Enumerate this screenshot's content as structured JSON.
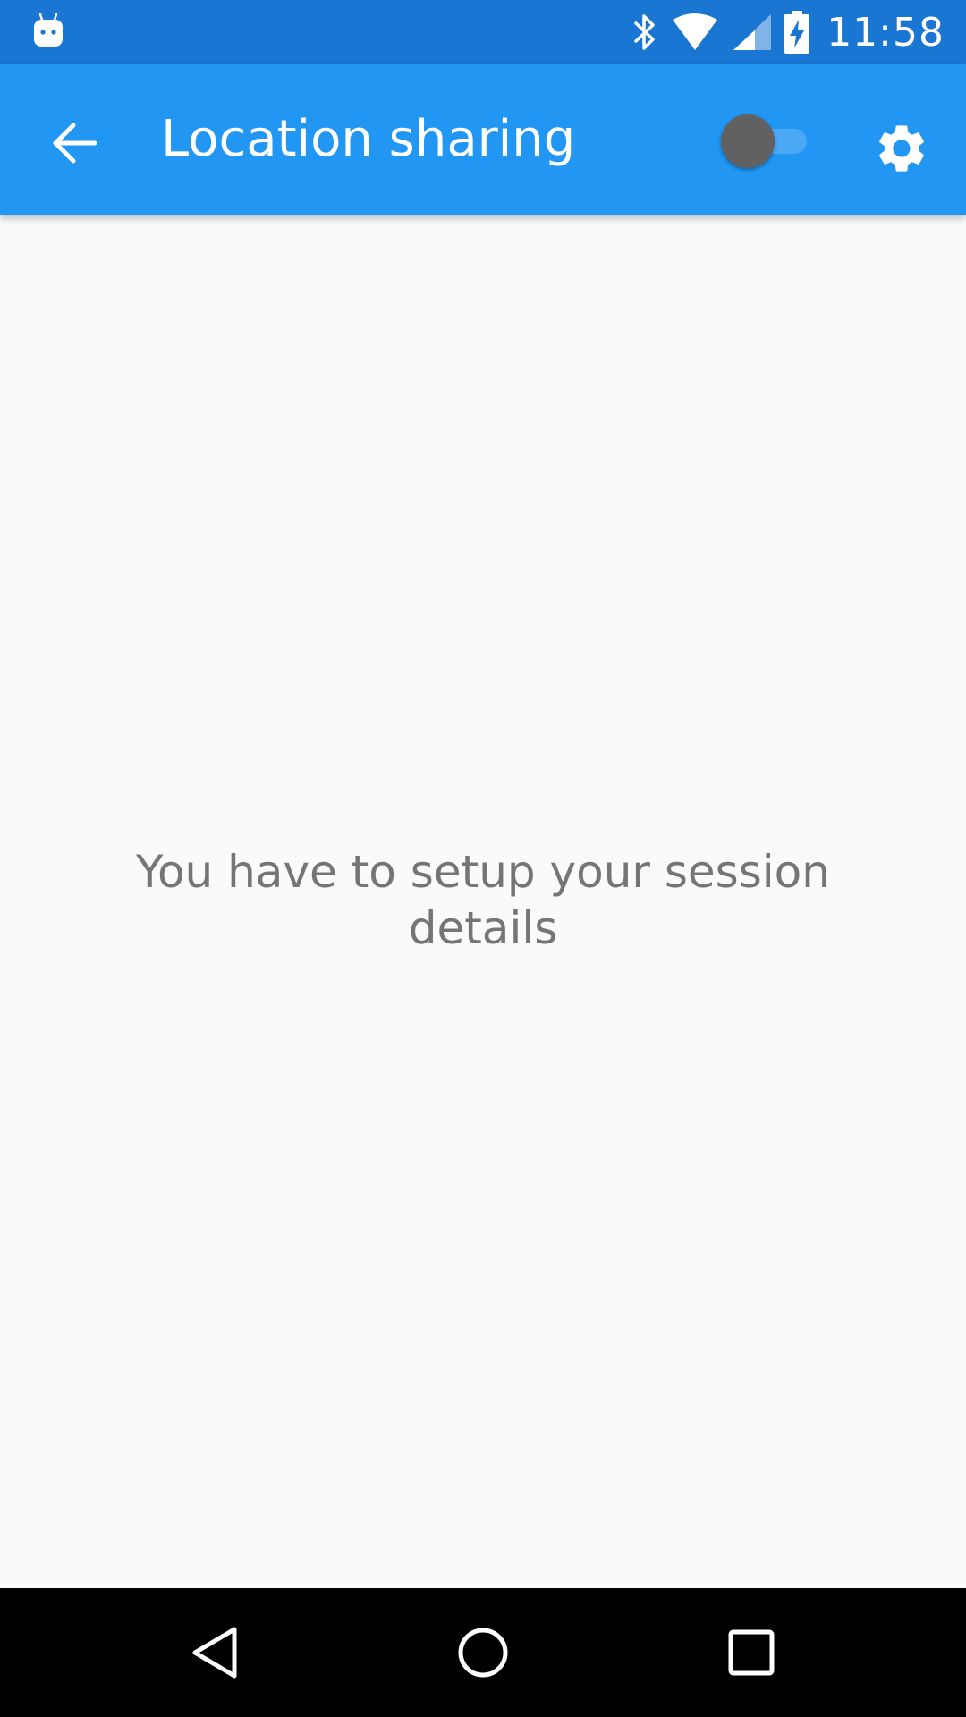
{
  "status_bar": {
    "time": "11:58",
    "icons": [
      "android-notification-icon",
      "bluetooth-icon",
      "wifi-icon",
      "cell-signal-icon",
      "battery-charging-icon"
    ]
  },
  "app_bar": {
    "title": "Location sharing",
    "back_icon": "arrow-back-icon",
    "toggle_state": "off",
    "settings_icon": "gear-icon",
    "colors": {
      "background": "#2196f3",
      "status_bar": "#1976d2"
    }
  },
  "content": {
    "message": "You have to setup your session details"
  },
  "nav_bar": {
    "icons": [
      "back-triangle-icon",
      "home-circle-icon",
      "recents-square-icon"
    ]
  }
}
